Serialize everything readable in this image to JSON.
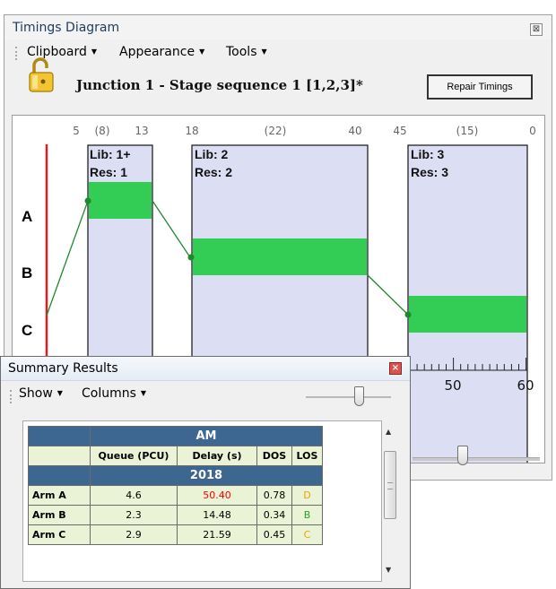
{
  "timings": {
    "title": "Timings Diagram",
    "menu": {
      "clipboard": "Clipboard",
      "appearance": "Appearance",
      "tools": "Tools"
    },
    "stage_title": "Junction 1 - Stage sequence 1 [1,2,3]*",
    "repair_button": "Repair Timings",
    "diagram": {
      "top_numbers": [
        "5",
        "(8)",
        "13",
        "18",
        "(22)",
        "40",
        "45",
        "(15)",
        "0"
      ],
      "rows": [
        "A",
        "B",
        "C"
      ],
      "stages": [
        {
          "lib": "Lib: 1+",
          "res": "Res: 1"
        },
        {
          "lib": "Lib: 2",
          "res": "Res: 2"
        },
        {
          "lib": "Lib: 3",
          "res": "Res: 3"
        }
      ],
      "scale_labels": [
        "50",
        "60"
      ]
    }
  },
  "summary": {
    "title": "Summary Results",
    "menu": {
      "show": "Show",
      "columns": "Columns"
    },
    "table": {
      "period": "AM",
      "headers": [
        "Queue (PCU)",
        "Delay (s)",
        "DOS",
        "LOS"
      ],
      "year": "2018",
      "rows": [
        {
          "arm": "Arm A",
          "queue": "4.6",
          "delay": "50.40",
          "dos": "0.78",
          "los": "D"
        },
        {
          "arm": "Arm B",
          "queue": "2.3",
          "delay": "14.48",
          "dos": "0.34",
          "los": "B"
        },
        {
          "arm": "Arm C",
          "queue": "2.9",
          "delay": "21.59",
          "dos": "0.45",
          "los": "C"
        }
      ]
    }
  },
  "colors": {
    "header_blue": "#3d6691",
    "cell_green": "#eaf3d5",
    "stage_fill": "#dcdff4",
    "green_bar": "#33cc55",
    "delay_high": "#ff0000",
    "los_d": "#e8a600",
    "los_b": "#2e9e2e",
    "los_c": "#e8a600"
  }
}
